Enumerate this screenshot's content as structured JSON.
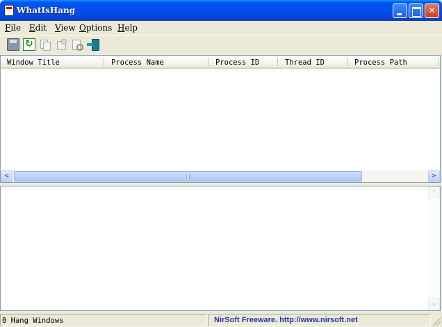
{
  "window": {
    "title": "WhatIsHang",
    "icon": "app-icon",
    "controls": [
      "minimize-icon",
      "maximize-icon",
      "close-icon"
    ],
    "close_glyph": "✕"
  },
  "menu": {
    "items": [
      {
        "label": "File"
      },
      {
        "label": "Edit"
      },
      {
        "label": "View"
      },
      {
        "label": "Options"
      },
      {
        "label": "Help"
      }
    ]
  },
  "toolbar": {
    "icons": [
      "save-icon",
      "refresh-icon",
      "copy-icon",
      "properties-icon",
      "find-icon",
      "exit-icon"
    ]
  },
  "list": {
    "columns": [
      {
        "label": "Window Title"
      },
      {
        "label": "Process Name"
      },
      {
        "label": "Process ID"
      },
      {
        "label": "Thread ID"
      },
      {
        "label": "Process Path"
      }
    ],
    "rows": []
  },
  "scroll": {
    "left_glyph": "<",
    "right_glyph": ">",
    "up_glyph": "^",
    "down_glyph": "v"
  },
  "status": {
    "left": "0 Hang Windows",
    "right": "NirSoft Freeware.  http://www.nirsoft.net"
  }
}
